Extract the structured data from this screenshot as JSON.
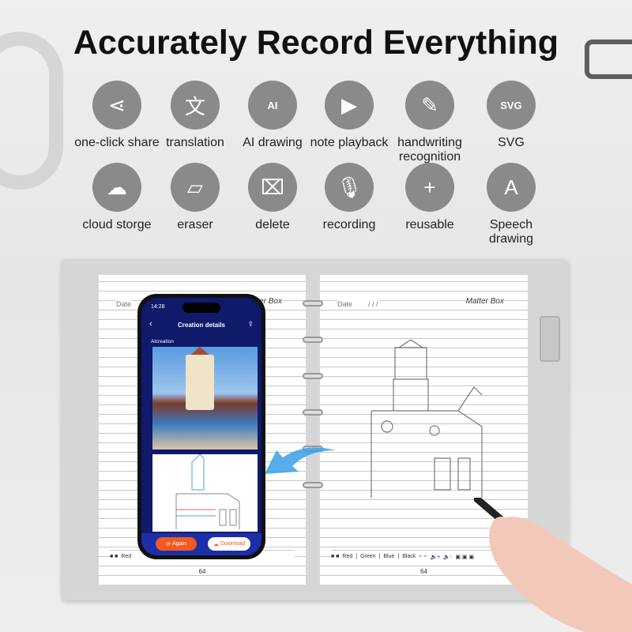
{
  "title": "Accurately Record Everything",
  "features": [
    {
      "label": "one-click share",
      "icon": "share-icon"
    },
    {
      "label": "translation",
      "icon": "translate-icon"
    },
    {
      "label": "AI drawing",
      "icon": "ai-chip-icon"
    },
    {
      "label": "note playback",
      "icon": "play-icon"
    },
    {
      "label": "handwriting recognition",
      "icon": "handwriting-icon"
    },
    {
      "label": "SVG",
      "icon": "svg-file-icon"
    },
    {
      "label": "cloud storge",
      "icon": "cloud-icon"
    },
    {
      "label": "eraser",
      "icon": "eraser-icon"
    },
    {
      "label": "delete",
      "icon": "broom-icon"
    },
    {
      "label": "recording",
      "icon": "microphone-icon"
    },
    {
      "label": "reusable",
      "icon": "add-page-icon"
    },
    {
      "label": "Speech drawing",
      "icon": "speech-ai-icon"
    }
  ],
  "notebook": {
    "date_label": "Date",
    "date_slashes": "/   /   /",
    "brand": "Matter Box",
    "toolbar_colors": [
      "Red",
      "Green",
      "Blue",
      "Black"
    ],
    "page_number": "64"
  },
  "phone": {
    "time": "14:28",
    "screen_title": "Creation details",
    "section_label": "Alcreation",
    "again_label": "Again",
    "download_label": "Download",
    "accent": "#f15a22",
    "screen_bg": "#0f1a6b"
  }
}
